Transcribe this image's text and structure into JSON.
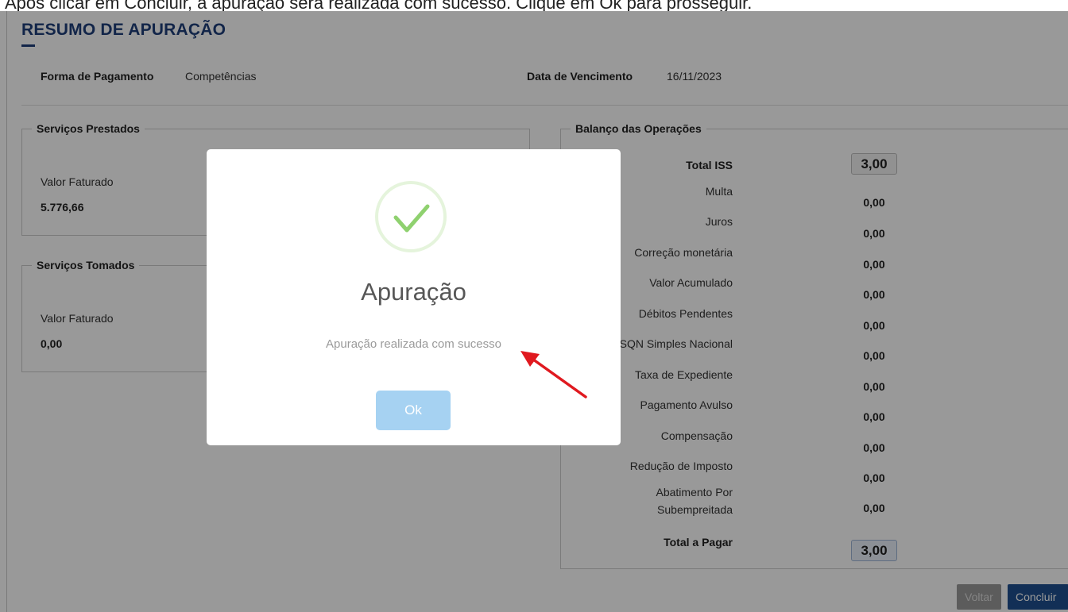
{
  "top_fragment": "Após clicar em Concluir, a apuração será realizada com sucesso. Clique em Ok para prosseguir.",
  "header": {
    "title": "RESUMO DE APURAÇÃO",
    "forma_pagamento_label": "Forma de Pagamento",
    "forma_pagamento_value": "Competências",
    "data_vencimento_label": "Data de Vencimento",
    "data_vencimento_value": "16/11/2023"
  },
  "servicos_prestados": {
    "legend": "Serviços Prestados",
    "valor_label": "Valor Faturado",
    "valor": "5.776,66"
  },
  "servicos_tomados": {
    "legend": "Serviços Tomados",
    "valor_label": "Valor Faturado",
    "valor": "0,00"
  },
  "balanco": {
    "legend": "Balanço das Operações",
    "total_iss_label": "Total ISS",
    "total_iss_value": "3,00",
    "rows": [
      {
        "label": "Multa",
        "value": "0,00"
      },
      {
        "label": "Juros",
        "value": "0,00"
      },
      {
        "label": "Correção monetária",
        "value": "0,00"
      },
      {
        "label": "Valor Acumulado",
        "value": "0,00"
      },
      {
        "label": "Débitos Pendentes",
        "value": "0,00"
      },
      {
        "label": "ISSQN Simples Nacional",
        "value": "0,00"
      },
      {
        "label": "Taxa de Expediente",
        "value": "0,00"
      },
      {
        "label": "Pagamento Avulso",
        "value": "0,00"
      },
      {
        "label": "Compensação",
        "value": "0,00"
      },
      {
        "label": "Redução de Imposto",
        "value": "0,00"
      },
      {
        "label": "Abatimento Por Subempreitada",
        "value": "0,00"
      }
    ],
    "total_pagar_label": "Total a Pagar",
    "total_pagar_value": "3,00"
  },
  "buttons": {
    "voltar": "Voltar",
    "concluir": "Concluir"
  },
  "modal": {
    "title": "Apuração",
    "message": "Apuração realizada com sucesso",
    "ok": "Ok"
  },
  "colors": {
    "title_blue": "#1f3f7a",
    "ok_button": "#a6d2f2",
    "check_green": "#8fd16f",
    "arrow_red": "#e0191f"
  }
}
